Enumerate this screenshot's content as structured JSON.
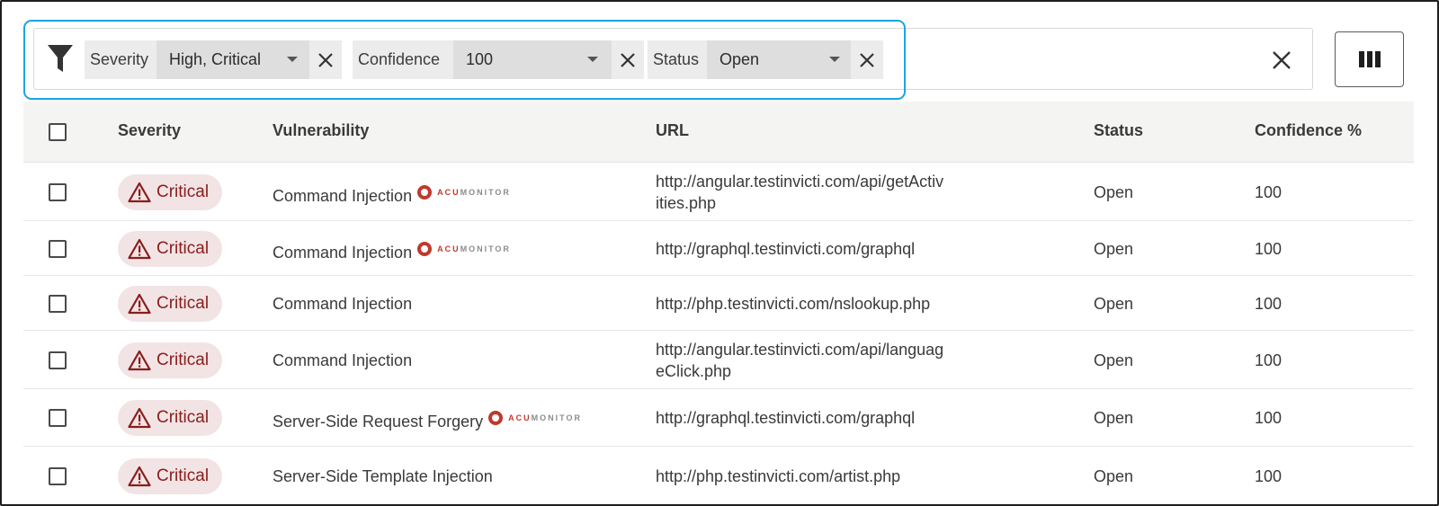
{
  "filters": [
    {
      "label": "Severity",
      "value": "High, Critical"
    },
    {
      "label": "Confidence",
      "value": "100"
    },
    {
      "label": "Status",
      "value": "Open"
    }
  ],
  "icons": {
    "filter": "filter-funnel-icon",
    "remove": "close-icon",
    "clear_all": "close-icon",
    "columns": "columns-icon",
    "severity": "warning-triangle-icon",
    "acumonitor": "acumonitor-logo-icon"
  },
  "table": {
    "headers": {
      "severity": "Severity",
      "vulnerability": "Vulnerability",
      "url": "URL",
      "status": "Status",
      "confidence": "Confidence %"
    },
    "rows": [
      {
        "severity": "Critical",
        "vulnerability": "Command Injection",
        "acumonitor": true,
        "url_line1": "http://angular.testinvicti.com/api/getActiv",
        "url_line2": "ities.php",
        "status": "Open",
        "confidence": "100"
      },
      {
        "severity": "Critical",
        "vulnerability": "Command Injection",
        "acumonitor": true,
        "url_line1": "http://graphql.testinvicti.com/graphql",
        "url_line2": "",
        "status": "Open",
        "confidence": "100"
      },
      {
        "severity": "Critical",
        "vulnerability": "Command Injection",
        "acumonitor": false,
        "url_line1": "http://php.testinvicti.com/nslookup.php",
        "url_line2": "",
        "status": "Open",
        "confidence": "100"
      },
      {
        "severity": "Critical",
        "vulnerability": "Command Injection",
        "acumonitor": false,
        "url_line1": "http://angular.testinvicti.com/api/languag",
        "url_line2": "eClick.php",
        "status": "Open",
        "confidence": "100"
      },
      {
        "severity": "Critical",
        "vulnerability": "Server-Side Request Forgery",
        "acumonitor": true,
        "url_line1": "http://graphql.testinvicti.com/graphql",
        "url_line2": "",
        "status": "Open",
        "confidence": "100"
      },
      {
        "severity": "Critical",
        "vulnerability": "Server-Side Template Injection",
        "acumonitor": false,
        "url_line1": "http://php.testinvicti.com/artist.php",
        "url_line2": "",
        "status": "Open",
        "confidence": "100"
      }
    ]
  },
  "acumonitor_logo": {
    "part1": "ACU",
    "part2": "MONITOR"
  },
  "colors": {
    "highlight": "#1aa5e0",
    "critical_text": "#8a1c1c",
    "critical_bg": "#f2e4e4"
  }
}
